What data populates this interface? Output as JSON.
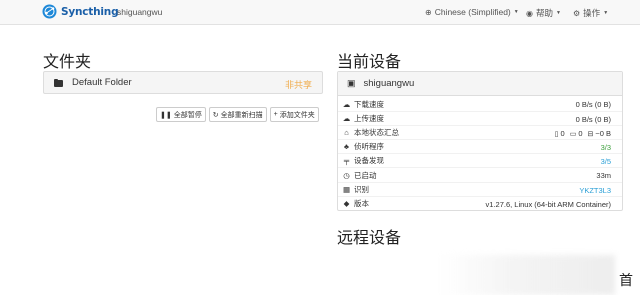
{
  "navbar": {
    "brand": "Syncthing",
    "device_name": "shiguangwu",
    "language": "Chinese (Simplified)",
    "help": "帮助",
    "actions": "操作"
  },
  "folders": {
    "heading": "文件夹",
    "items": [
      {
        "label": "Default Folder",
        "status": "非共享"
      }
    ],
    "buttons": {
      "pause_all": "全部暂停",
      "rescan_all": "全部重新扫描",
      "add_folder": "添加文件夹"
    }
  },
  "this_device": {
    "heading": "当前设备",
    "name": "shiguangwu",
    "rows": [
      {
        "icon": "download-icon",
        "label": "下载速度",
        "value": "0 B/s (0 B)"
      },
      {
        "icon": "upload-icon",
        "label": "上传速度",
        "value": "0 B/s (0 B)"
      },
      {
        "icon": "home-icon",
        "label": "本地状态汇总",
        "value": ""
      },
      {
        "icon": "sitemap-icon",
        "label": "侦听程序",
        "value": "3/3"
      },
      {
        "icon": "signpost-icon",
        "label": "设备发现",
        "value": "3/5"
      },
      {
        "icon": "clock-icon",
        "label": "已启动",
        "value": "33m"
      },
      {
        "icon": "qrcode-icon",
        "label": "识别",
        "value": "YKZT3L3"
      },
      {
        "icon": "tag-icon",
        "label": "版本",
        "value": "v1.27.6, Linux (64-bit ARM Container)"
      }
    ],
    "local_state": {
      "files": "0",
      "dirs": "0",
      "size": "~0 B"
    }
  },
  "remote_devices": {
    "heading": "远程设备"
  },
  "colors": {
    "brand": "#1a5fa8",
    "status_warning": "#f0ad4e",
    "link": "#2a9fd6",
    "success": "#3c9f3c"
  },
  "corner_text": "首"
}
